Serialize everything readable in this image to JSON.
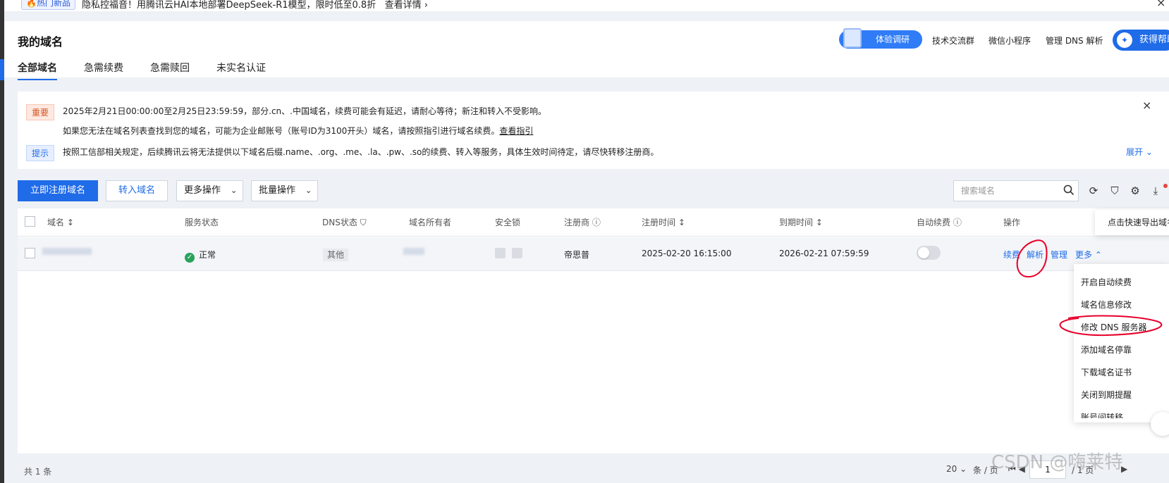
{
  "banner": {
    "tag": "🔥热门新品",
    "text": "隐私控福音！用腾讯云HAI本地部署DeepSeek-R1模型，限时低至0.8折",
    "link": "查看详情 ›",
    "close": "×"
  },
  "header": {
    "title": "我的域名",
    "tabs": [
      "全部域名",
      "急需续费",
      "急需赎回",
      "未实名认证"
    ],
    "survey": "体验调研",
    "links": [
      "技术交流群",
      "微信小程序",
      "管理 DNS 解析"
    ],
    "help": "获得帮助"
  },
  "notice": {
    "tag_important": "重要",
    "line1": "2025年2月21日00:00:00至2月25日23:59:59，部分.cn、.中国域名，续费可能会有延迟，请耐心等待；新注和转入不受影响。",
    "line2": "如果您无法在域名列表查找到您的域名，可能为企业邮账号（账号ID为3100开头）域名，请按照指引进行域名续费。",
    "line2_link": "查看指引",
    "tag_tip": "提示",
    "line3": "按照工信部相关规定，后续腾讯云将无法提供以下域名后缀.name、.org、.me、.la、.pw、.so的续费、转入等服务，具体生效时间待定，请尽快转移注册商。",
    "expand": "展开 ⌄",
    "close": "×"
  },
  "toolbar": {
    "register": "立即注册域名",
    "transfer": "转入域名",
    "more_ops": "更多操作",
    "batch_ops": "批量操作",
    "search_placeholder": "搜索域名",
    "export_tip": "点击快速导出域名"
  },
  "table": {
    "headers": [
      "域名 ↕",
      "服务状态",
      "DNS状态",
      "域名所有者",
      "安全锁",
      "注册商 ⓘ",
      "注册时间 ↕",
      "到期时间 ↕",
      "自动续费 ⓘ",
      "操作"
    ],
    "row": {
      "status": "正常",
      "dns": "其他",
      "registrar": "帝思普",
      "reg_time": "2025-02-20 16:15:00",
      "exp_time": "2026-02-21 07:59:59",
      "auto_renew": false,
      "ops": [
        "续费",
        "解析",
        "管理",
        "更多 ⌃"
      ]
    }
  },
  "dropdown": [
    "开启自动续费",
    "域名信息修改",
    "修改 DNS 服务器",
    "添加域名停靠",
    "下载域名证书",
    "关闭到期提醒",
    "账号间转移"
  ],
  "footer": {
    "total": "共 1 条",
    "page_size": "20 ⌄",
    "per_page": "条 / 页",
    "page": "1",
    "pages": "/ 1 页"
  },
  "watermark": "CSDN @嗨莱特",
  "colors": {
    "accent": "#1f6be8",
    "annotation": "#e8002a"
  }
}
